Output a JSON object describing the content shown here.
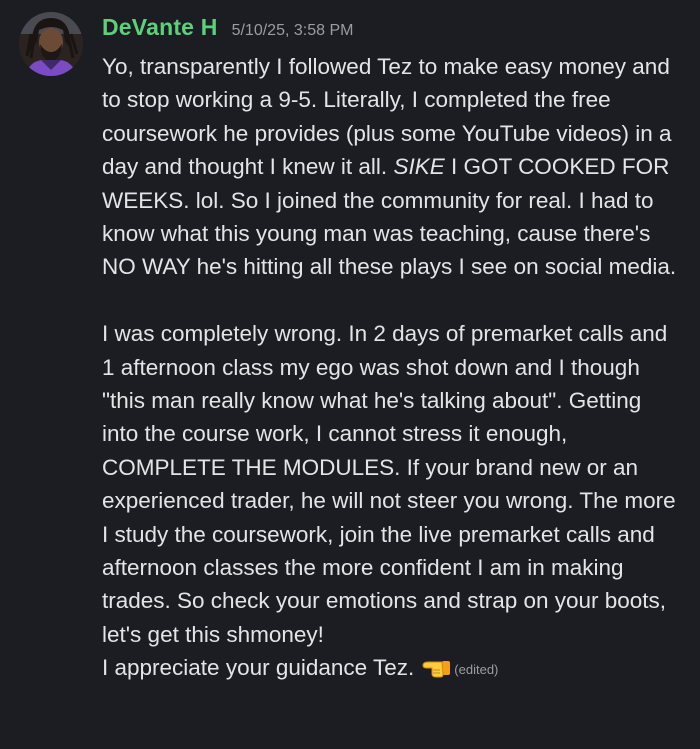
{
  "message": {
    "author": "DeVante H",
    "timestamp": "5/10/25, 3:58 PM",
    "username_color": "#5bd17a",
    "avatar_icon": "user-avatar",
    "para1": {
      "before_italic": "Yo, transparently I followed Tez to make easy money and to stop working a 9-5. Literally, I completed the free coursework he provides (plus some YouTube videos) in a day and thought I knew it all. ",
      "italic": "SIKE",
      "after_italic": " I GOT COOKED FOR WEEKS. lol. So I joined the community for real. I had to know what this young man was teaching, cause there's NO WAY he's hitting all these plays I see on social media."
    },
    "para2": "I was completely wrong. In 2 days of premarket calls and 1 afternoon class my ego was shot down and I though \"this man really know what he's talking about\". Getting into the course work, I cannot stress it enough, COMPLETE THE MODULES. If your brand new or an experienced trader, he will not steer you wrong. The more I study the coursework, join the live premarket calls and afternoon classes the more confident I am in making trades. So check your emotions and strap on your boots, let's get this shmoney!",
    "para3": "I appreciate your guidance Tez.",
    "emoji_icon": "pointing-hand-emoji",
    "edited_label": "(edited)"
  }
}
